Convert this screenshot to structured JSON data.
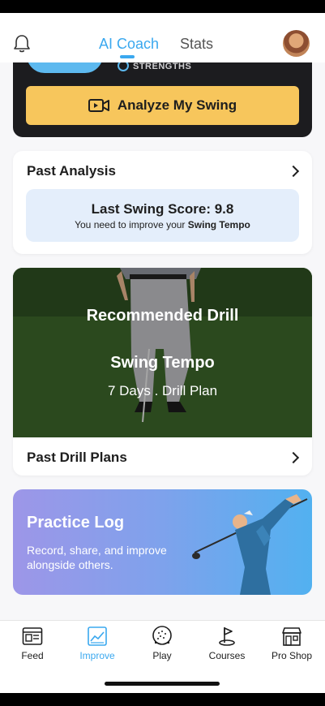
{
  "header": {
    "tabs": [
      {
        "label": "AI Coach",
        "active": true
      },
      {
        "label": "Stats",
        "active": false
      }
    ],
    "icons": {
      "bell": "bell-icon",
      "avatar": "user-avatar"
    },
    "accent_color": "#3aa8ef"
  },
  "top_card": {
    "strengths_label": "STRENGTHS",
    "analyze_button_label": "Analyze My Swing",
    "analyze_button_icon": "video-icon",
    "button_color": "#f7c65c"
  },
  "past_analysis": {
    "title": "Past Analysis",
    "score_title": "Last Swing Score: 9.8",
    "score_sub_prefix": "You need to improve your ",
    "score_sub_emphasis": "Swing Tempo"
  },
  "drill": {
    "heading": "Recommended Drill",
    "name": "Swing Tempo",
    "meta": "7 Days  .  Drill Plan",
    "past_plans_label": "Past Drill Plans"
  },
  "practice_log": {
    "title": "Practice Log",
    "subtitle": "Record, share, and improve alongside others."
  },
  "bottom_nav": [
    {
      "label": "Feed",
      "icon": "feed-icon",
      "active": false
    },
    {
      "label": "Improve",
      "icon": "chart-icon",
      "active": true
    },
    {
      "label": "Play",
      "icon": "golf-ball-icon",
      "active": false
    },
    {
      "label": "Courses",
      "icon": "flag-icon",
      "active": false
    },
    {
      "label": "Pro Shop",
      "icon": "shop-icon",
      "active": false
    }
  ]
}
